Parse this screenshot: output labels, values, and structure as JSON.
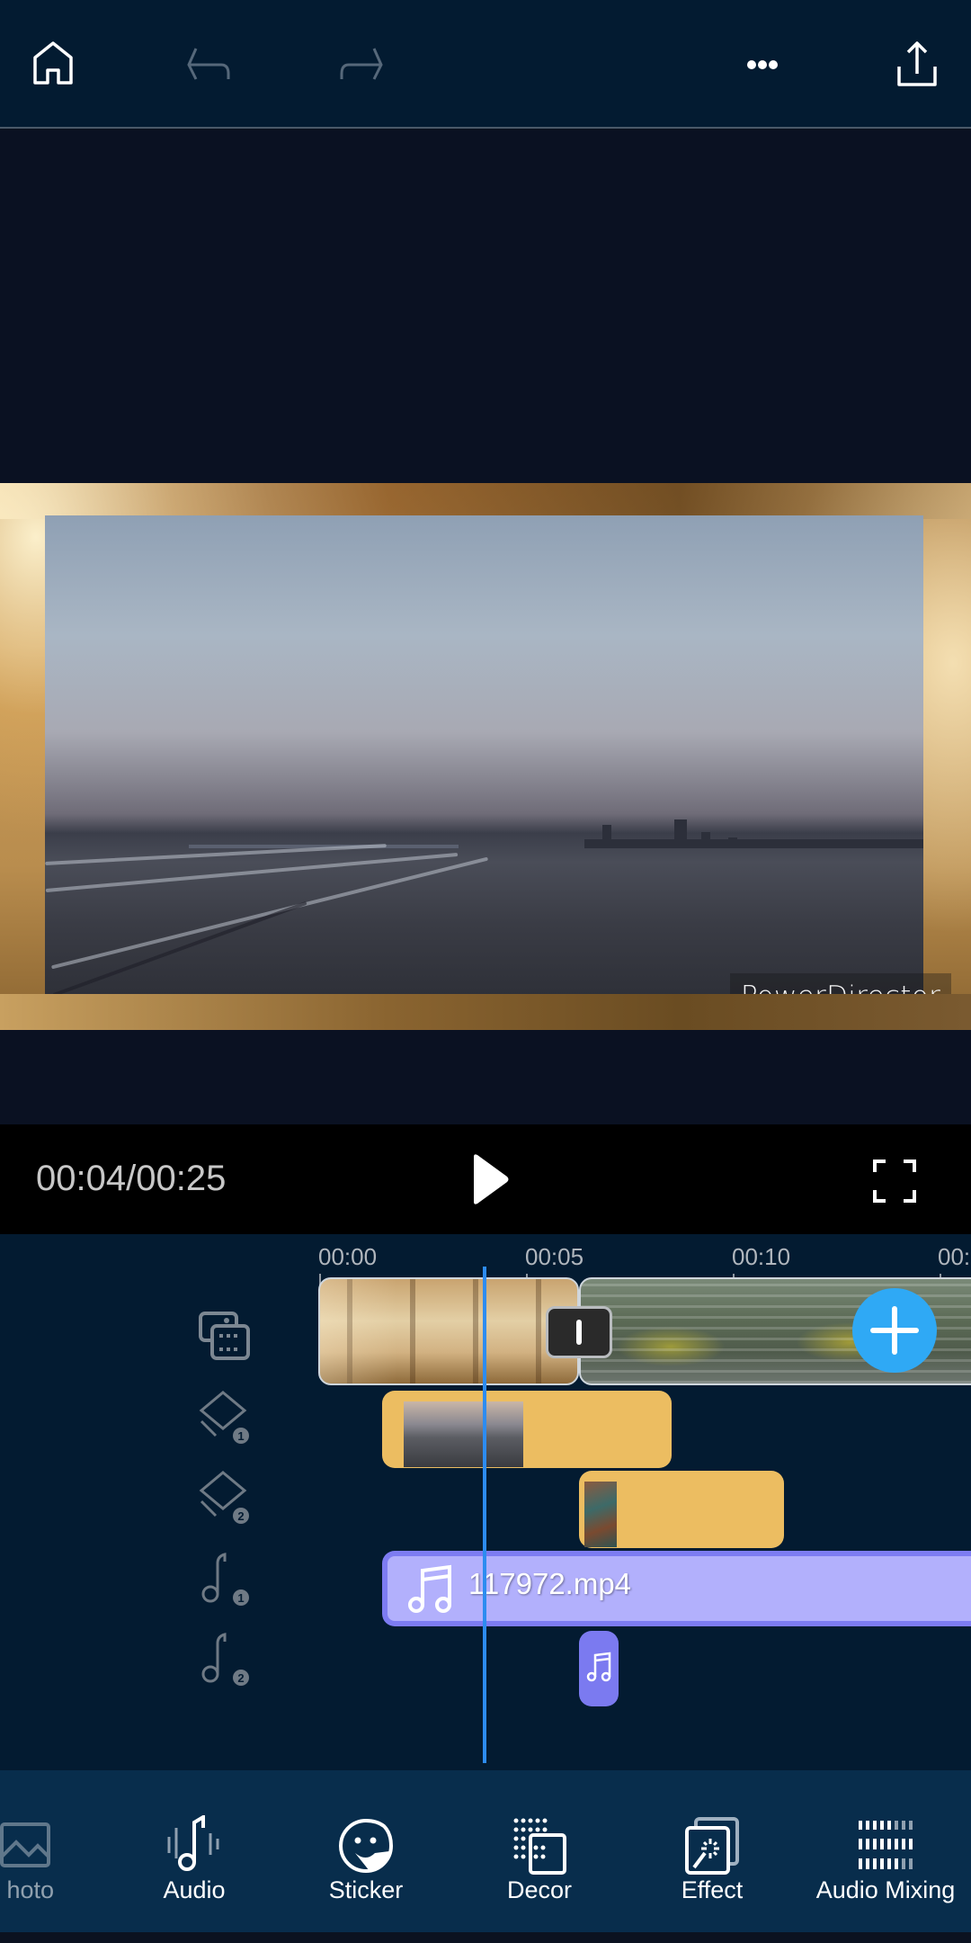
{
  "toolbar": {
    "home": "home-icon",
    "undo": "undo-icon",
    "redo": "redo-icon",
    "more": "more-icon",
    "export": "export-icon"
  },
  "preview": {
    "watermark": "PowerDirector"
  },
  "playback": {
    "timecode": "00:04/00:25",
    "play": "play-icon",
    "fullscreen": "fullscreen-icon"
  },
  "timeline": {
    "ruler": [
      "00:00",
      "00:05",
      "00:10",
      "00:"
    ],
    "tracks": [
      {
        "name": "video-track",
        "icon": "video-photo-icon"
      },
      {
        "name": "overlay-track-1",
        "icon": "layer-icon",
        "badge": "1"
      },
      {
        "name": "overlay-track-2",
        "icon": "layer-icon",
        "badge": "2"
      },
      {
        "name": "audio-track-1",
        "icon": "music-note-icon",
        "badge": "1"
      },
      {
        "name": "audio-track-2",
        "icon": "music-note-icon",
        "badge": "2"
      }
    ],
    "audio_clip_name": "117972.mp4",
    "playhead_time": "00:04"
  },
  "bottom_tools": [
    {
      "label": "Photo",
      "visible_label": "hoto",
      "icon": "photo-icon"
    },
    {
      "label": "Audio",
      "icon": "audio-icon"
    },
    {
      "label": "Sticker",
      "icon": "sticker-icon"
    },
    {
      "label": "Decor",
      "icon": "decor-icon"
    },
    {
      "label": "Effect",
      "icon": "effect-icon"
    },
    {
      "label": "Audio Mixing",
      "icon": "audio-mixing-icon"
    }
  ],
  "colors": {
    "accent": "#2fa9f5",
    "playhead": "#2d8cf0",
    "overlay_clip": "#ecbd61",
    "audio_clip": "#b2b0fc",
    "audio_clip_border": "#7d7cf2"
  }
}
